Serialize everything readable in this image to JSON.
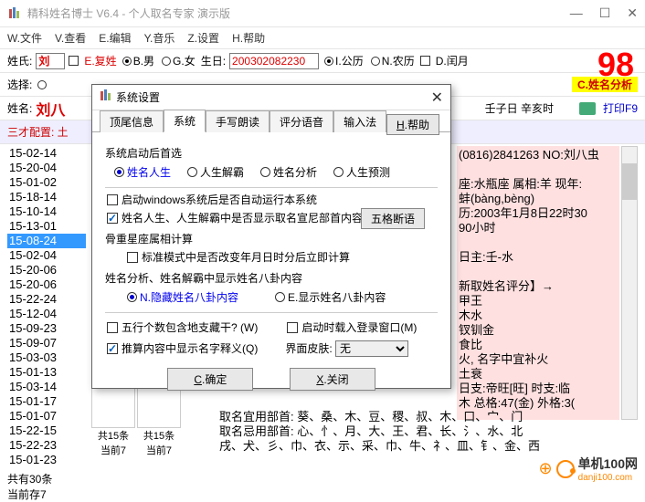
{
  "titlebar": {
    "title": "精科姓名博士 V6.4 - 个人取名专家 演示版",
    "min": "—",
    "max": "☐",
    "close": "✕"
  },
  "menubar": {
    "items": [
      "W.文件",
      "V.查看",
      "E.编辑",
      "Y.音乐",
      "Z.设置",
      "H.帮助"
    ]
  },
  "form": {
    "surname_label": "姓氏:",
    "surname_value": "刘",
    "compound": "E.复姓",
    "gender_m": "B.男",
    "gender_f": "G.女",
    "birth_label": "生日:",
    "birth_value": "200302082230",
    "cal_solar": "I.公历",
    "cal_lunar": "N.农历",
    "leap": "D.闰月",
    "score": "98",
    "select_label": "选择:",
    "analysis_btn": "C.姓名分析",
    "name_label": "姓名:",
    "name_value": "刘八",
    "extra": "壬子日 辛亥时",
    "print": "打印F9",
    "sancai": "三才配置: 土"
  },
  "leftlist": {
    "items": [
      "15-02-14",
      "15-20-04",
      "15-01-02",
      "15-18-14",
      "15-10-14",
      "15-13-01",
      "15-08-24",
      "15-02-04",
      "15-20-06",
      "15-20-06",
      "15-22-24",
      "15-12-04",
      "15-09-23",
      "15-09-07",
      "15-03-03",
      "15-01-13",
      "15-03-14",
      "15-01-17",
      "15-01-07",
      "15-22-15",
      "15-22-23",
      "15-01-23"
    ],
    "selected_index": 6,
    "footer1": "共有30条",
    "footer2": "当前存7"
  },
  "smallcols": {
    "c1a": "共15条",
    "c1b": "当前7",
    "c2a": "共15条",
    "c2b": "当前7"
  },
  "pink": {
    "l1": "(0816)2841263  NO:刘八虫",
    "l2": "座:水瓶座  属相:羊  现年:",
    "l3": "蚌(bàng,bèng)",
    "l4": "历:2003年1月8日22时30",
    "l5": "90小时",
    "l6": "       日主:壬-水",
    "l7": "新取姓名评分】→",
    "l8": "          甲王",
    "l9": "          木水",
    "l10": "          钗钏金",
    "l11": "          食比",
    "l12": "火, 名字中宜补火",
    "l13": "土衰",
    "l14": "   日支:帝旺[旺]   时支:临",
    "l15": "木  总格:47(金)  外格:3("
  },
  "bottom": {
    "l1": "取名宜用部首: 葵、桑、木、豆、稷、叔、木、口、宀、门",
    "l2": "取名忌用部首: 心、忄、月、大、王、君、长、氵、水、北",
    "l3": "戌、犬、彡、巾、衣、示、采、巾、牛、礻、皿、钅、金、西"
  },
  "logo": {
    "text": "单机100网",
    "url": "danji100.com"
  },
  "modal": {
    "title": "系统设置",
    "tabs": [
      "顶尾信息",
      "系统",
      "手写朗读",
      "评分语音",
      "输入法"
    ],
    "active_tab": 1,
    "help": "H.帮助",
    "group1_label": "系统启动后首选",
    "radios": [
      "姓名人生",
      "人生解霸",
      "姓名分析",
      "人生预测"
    ],
    "radio_selected": 0,
    "chk_autostart": "启动windows系统后是否自动运行本系统",
    "chk_showdept": "姓名人生、人生解霸中是否显示取名宣尼部首内容?",
    "btn_wuge": "五格断语",
    "group2_label": "骨重星座属相计算",
    "chk_std": "标准模式中是否改变年月日时分后立即计算",
    "group3_label": "姓名分析、姓名解霸中显示姓名八卦内容",
    "r_hide": "N.隐藏姓名八卦内容",
    "r_show": "E.显示姓名八卦内容",
    "chk_wuxing": "五行个数包含地支藏干? (W)",
    "chk_login": "启动时载入登录窗口(M)",
    "chk_meaning": "推算内容中显示名字释义(Q)",
    "skin_label": "界面皮肤:",
    "skin_value": "无",
    "ok": "C.确定",
    "cancel": "X.关闭"
  }
}
